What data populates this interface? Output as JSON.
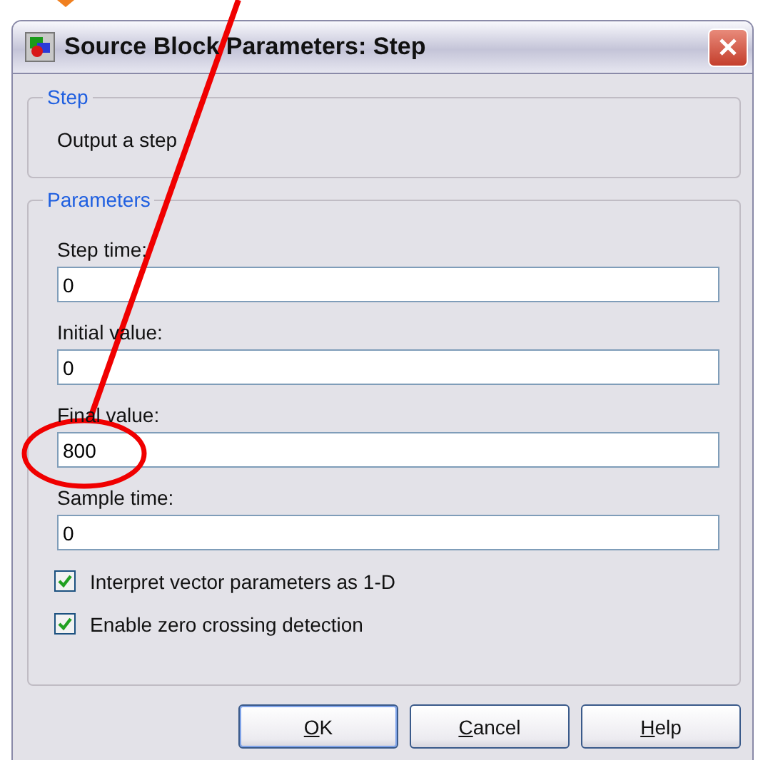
{
  "window": {
    "title": "Source Block Parameters: Step"
  },
  "step_group": {
    "title": "Step",
    "description": "Output a step"
  },
  "parameters_group": {
    "title": "Parameters",
    "fields": [
      {
        "label": "Step time:",
        "value": "0"
      },
      {
        "label": "Initial value:",
        "value": "0"
      },
      {
        "label": "Final value:",
        "value": "800"
      },
      {
        "label": "Sample time:",
        "value": "0"
      }
    ],
    "checkboxes": [
      {
        "label": "Interpret vector parameters as 1-D",
        "checked": true
      },
      {
        "label": "Enable zero crossing detection",
        "checked": true
      }
    ]
  },
  "buttons": [
    {
      "key": "O",
      "rest": "K",
      "default": true
    },
    {
      "key": "C",
      "rest": "ancel",
      "default": false
    },
    {
      "key": "H",
      "rest": "elp",
      "default": false
    }
  ]
}
